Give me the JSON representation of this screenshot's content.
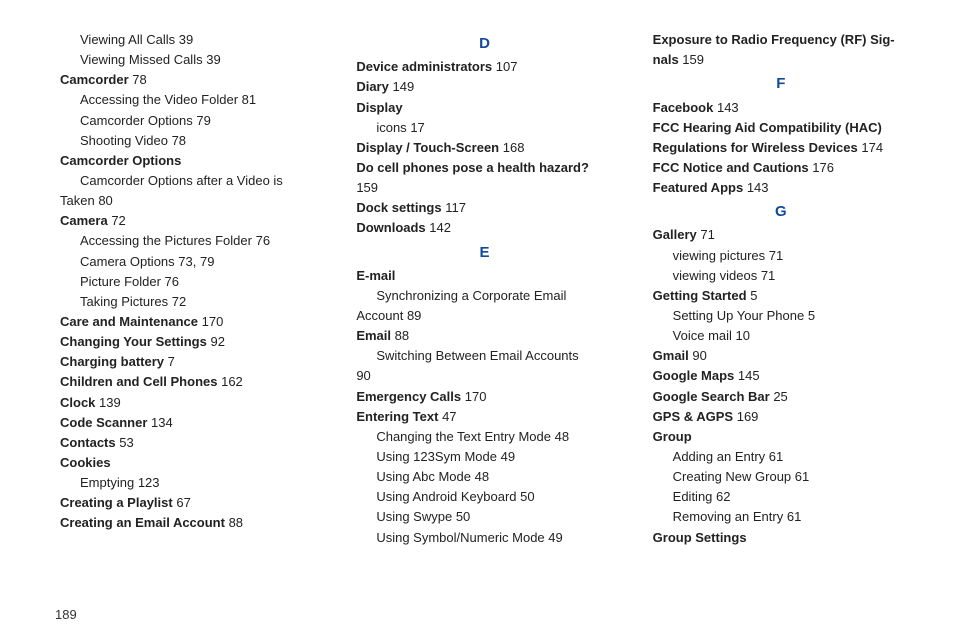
{
  "page_number": "189",
  "columns": [
    [
      {
        "kind": "entry",
        "level": 1,
        "text": "Viewing All Calls",
        "page": "39"
      },
      {
        "kind": "entry",
        "level": 1,
        "text": "Viewing Missed Calls",
        "page": "39"
      },
      {
        "kind": "entry",
        "level": 0,
        "bold": true,
        "text": "Camcorder",
        "page": "78"
      },
      {
        "kind": "entry",
        "level": 1,
        "text": "Accessing the Video Folder",
        "page": "81"
      },
      {
        "kind": "entry",
        "level": 1,
        "text": "Camcorder Options",
        "page": "79"
      },
      {
        "kind": "entry",
        "level": 1,
        "text": "Shooting Video",
        "page": "78"
      },
      {
        "kind": "entry",
        "level": 0,
        "bold": true,
        "text": "Camcorder Options"
      },
      {
        "kind": "entry",
        "level": 1,
        "text": "Camcorder Options after a Video is"
      },
      {
        "kind": "cont",
        "level": 2,
        "text": "Taken",
        "page": "80"
      },
      {
        "kind": "entry",
        "level": 0,
        "bold": true,
        "text": "Camera",
        "page": "72"
      },
      {
        "kind": "entry",
        "level": 1,
        "text": "Accessing the Pictures Folder",
        "page": "76"
      },
      {
        "kind": "entry",
        "level": 1,
        "text": "Camera Options",
        "page": "73, 79"
      },
      {
        "kind": "entry",
        "level": 1,
        "text": "Picture Folder",
        "page": "76"
      },
      {
        "kind": "entry",
        "level": 1,
        "text": "Taking Pictures",
        "page": "72"
      },
      {
        "kind": "entry",
        "level": 0,
        "bold": true,
        "text": "Care and Maintenance",
        "page": "170"
      },
      {
        "kind": "entry",
        "level": 0,
        "bold": true,
        "text": "Changing Your Settings",
        "page": "92"
      },
      {
        "kind": "entry",
        "level": 0,
        "bold": true,
        "text": "Charging battery",
        "page": "7"
      },
      {
        "kind": "entry",
        "level": 0,
        "bold": true,
        "text": "Children and Cell Phones",
        "page": "162"
      },
      {
        "kind": "entry",
        "level": 0,
        "bold": true,
        "text": "Clock",
        "page": "139"
      },
      {
        "kind": "entry",
        "level": 0,
        "bold": true,
        "text": "Code Scanner",
        "page": "134"
      },
      {
        "kind": "entry",
        "level": 0,
        "bold": true,
        "text": "Contacts",
        "page": "53"
      },
      {
        "kind": "entry",
        "level": 0,
        "bold": true,
        "text": "Cookies"
      },
      {
        "kind": "entry",
        "level": 1,
        "text": "Emptying",
        "page": "123"
      },
      {
        "kind": "entry",
        "level": 0,
        "bold": true,
        "text": "Creating a Playlist",
        "page": "67"
      },
      {
        "kind": "entry",
        "level": 0,
        "bold": true,
        "text": "Creating an Email Account",
        "page": "88"
      }
    ],
    [
      {
        "kind": "letter",
        "text": "D"
      },
      {
        "kind": "entry",
        "level": 0,
        "bold": true,
        "text": "Device administrators",
        "page": "107"
      },
      {
        "kind": "entry",
        "level": 0,
        "bold": true,
        "text": "Diary",
        "page": "149"
      },
      {
        "kind": "entry",
        "level": 0,
        "bold": true,
        "text": "Display"
      },
      {
        "kind": "entry",
        "level": 1,
        "text": "icons",
        "page": "17"
      },
      {
        "kind": "entry",
        "level": 0,
        "bold": true,
        "text": "Display / Touch-Screen",
        "page": "168"
      },
      {
        "kind": "entry",
        "level": 0,
        "bold": true,
        "text": "Do cell phones pose a health hazard?"
      },
      {
        "kind": "cont",
        "level": 0,
        "text": "",
        "page": "159"
      },
      {
        "kind": "entry",
        "level": 0,
        "bold": true,
        "text": "Dock settings",
        "page": "117"
      },
      {
        "kind": "entry",
        "level": 0,
        "bold": true,
        "text": "Downloads",
        "page": "142"
      },
      {
        "kind": "letter",
        "text": "E"
      },
      {
        "kind": "entry",
        "level": 0,
        "bold": true,
        "text": "E-mail"
      },
      {
        "kind": "entry",
        "level": 1,
        "text": "Synchronizing a Corporate Email"
      },
      {
        "kind": "cont",
        "level": 2,
        "text": "Account",
        "page": "89"
      },
      {
        "kind": "entry",
        "level": 0,
        "bold": true,
        "text": "Email",
        "page": "88"
      },
      {
        "kind": "entry",
        "level": 1,
        "text": "Switching Between Email Accounts"
      },
      {
        "kind": "cont",
        "level": 2,
        "text": "",
        "page": "90"
      },
      {
        "kind": "entry",
        "level": 0,
        "bold": true,
        "text": "Emergency Calls",
        "page": "170"
      },
      {
        "kind": "entry",
        "level": 0,
        "bold": true,
        "text": "Entering Text",
        "page": "47"
      },
      {
        "kind": "entry",
        "level": 1,
        "text": "Changing the Text Entry Mode",
        "page": "48"
      },
      {
        "kind": "entry",
        "level": 1,
        "text": "Using 123Sym Mode",
        "page": "49"
      },
      {
        "kind": "entry",
        "level": 1,
        "text": "Using Abc Mode",
        "page": "48"
      },
      {
        "kind": "entry",
        "level": 1,
        "text": "Using Android Keyboard",
        "page": "50"
      },
      {
        "kind": "entry",
        "level": 1,
        "text": "Using Swype",
        "page": "50"
      },
      {
        "kind": "entry",
        "level": 1,
        "text": "Using Symbol/Numeric Mode",
        "page": "49"
      }
    ],
    [
      {
        "kind": "entry",
        "level": 0,
        "bold": true,
        "text": "Exposure to Radio Frequency (RF) Sig-"
      },
      {
        "kind": "cont",
        "level": 0,
        "bold": true,
        "text": "nals",
        "page": "159"
      },
      {
        "kind": "letter",
        "text": "F"
      },
      {
        "kind": "entry",
        "level": 0,
        "bold": true,
        "text": "Facebook",
        "page": "143"
      },
      {
        "kind": "entry",
        "level": 0,
        "bold": true,
        "text": "FCC Hearing Aid Compatibility (HAC)"
      },
      {
        "kind": "cont",
        "level": 0,
        "bold": true,
        "text": "Regulations for Wireless Devices",
        "page": "174"
      },
      {
        "kind": "entry",
        "level": 0,
        "bold": true,
        "text": "FCC Notice and Cautions",
        "page": "176"
      },
      {
        "kind": "entry",
        "level": 0,
        "bold": true,
        "text": "Featured Apps",
        "page": "143"
      },
      {
        "kind": "letter",
        "text": "G"
      },
      {
        "kind": "entry",
        "level": 0,
        "bold": true,
        "text": "Gallery",
        "page": "71"
      },
      {
        "kind": "entry",
        "level": 1,
        "text": "viewing pictures",
        "page": "71"
      },
      {
        "kind": "entry",
        "level": 1,
        "text": "viewing videos",
        "page": "71"
      },
      {
        "kind": "entry",
        "level": 0,
        "bold": true,
        "text": "Getting Started",
        "page": "5"
      },
      {
        "kind": "entry",
        "level": 1,
        "text": "Setting Up Your Phone",
        "page": "5"
      },
      {
        "kind": "entry",
        "level": 1,
        "text": "Voice mail",
        "page": "10"
      },
      {
        "kind": "entry",
        "level": 0,
        "bold": true,
        "text": "Gmail",
        "page": "90"
      },
      {
        "kind": "entry",
        "level": 0,
        "bold": true,
        "text": "Google Maps",
        "page": "145"
      },
      {
        "kind": "entry",
        "level": 0,
        "bold": true,
        "text": "Google Search Bar",
        "page": "25"
      },
      {
        "kind": "entry",
        "level": 0,
        "bold": true,
        "text": "GPS & AGPS",
        "page": "169"
      },
      {
        "kind": "entry",
        "level": 0,
        "bold": true,
        "text": "Group"
      },
      {
        "kind": "entry",
        "level": 1,
        "text": "Adding an Entry",
        "page": "61"
      },
      {
        "kind": "entry",
        "level": 1,
        "text": "Creating New Group",
        "page": "61"
      },
      {
        "kind": "entry",
        "level": 1,
        "text": "Editing",
        "page": "62"
      },
      {
        "kind": "entry",
        "level": 1,
        "text": "Removing an Entry",
        "page": "61"
      },
      {
        "kind": "entry",
        "level": 0,
        "bold": true,
        "text": "Group Settings"
      }
    ]
  ]
}
